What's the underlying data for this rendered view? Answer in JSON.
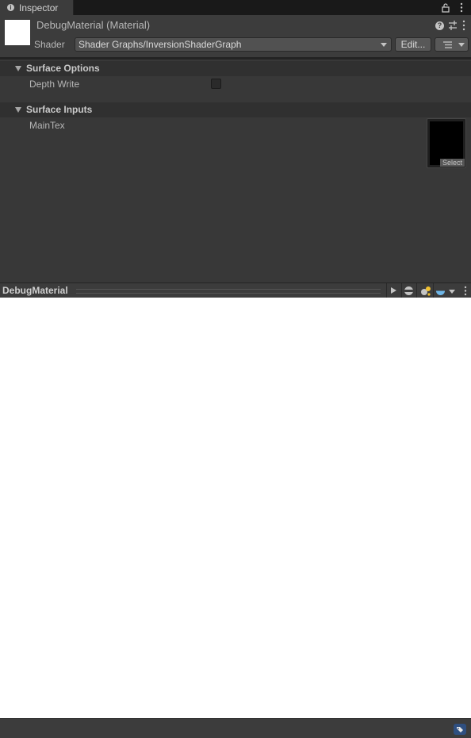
{
  "tab": {
    "title": "Inspector",
    "icon": "info-icon"
  },
  "header": {
    "material_title": "DebugMaterial (Material)",
    "shader_label": "Shader",
    "shader_value": "Shader Graphs/InversionShaderGraph",
    "edit_label": "Edit..."
  },
  "sections": {
    "surface_options": {
      "title": "Surface Options",
      "depth_write_label": "Depth Write",
      "depth_write_value": false
    },
    "surface_inputs": {
      "title": "Surface Inputs",
      "maintex_label": "MainTex",
      "select_label": "Select"
    }
  },
  "preview": {
    "title": "DebugMaterial"
  },
  "colors": {
    "panel_bg": "#383838",
    "header_bg": "#3c3c3c",
    "accent_blue": "#3d7ff0"
  }
}
